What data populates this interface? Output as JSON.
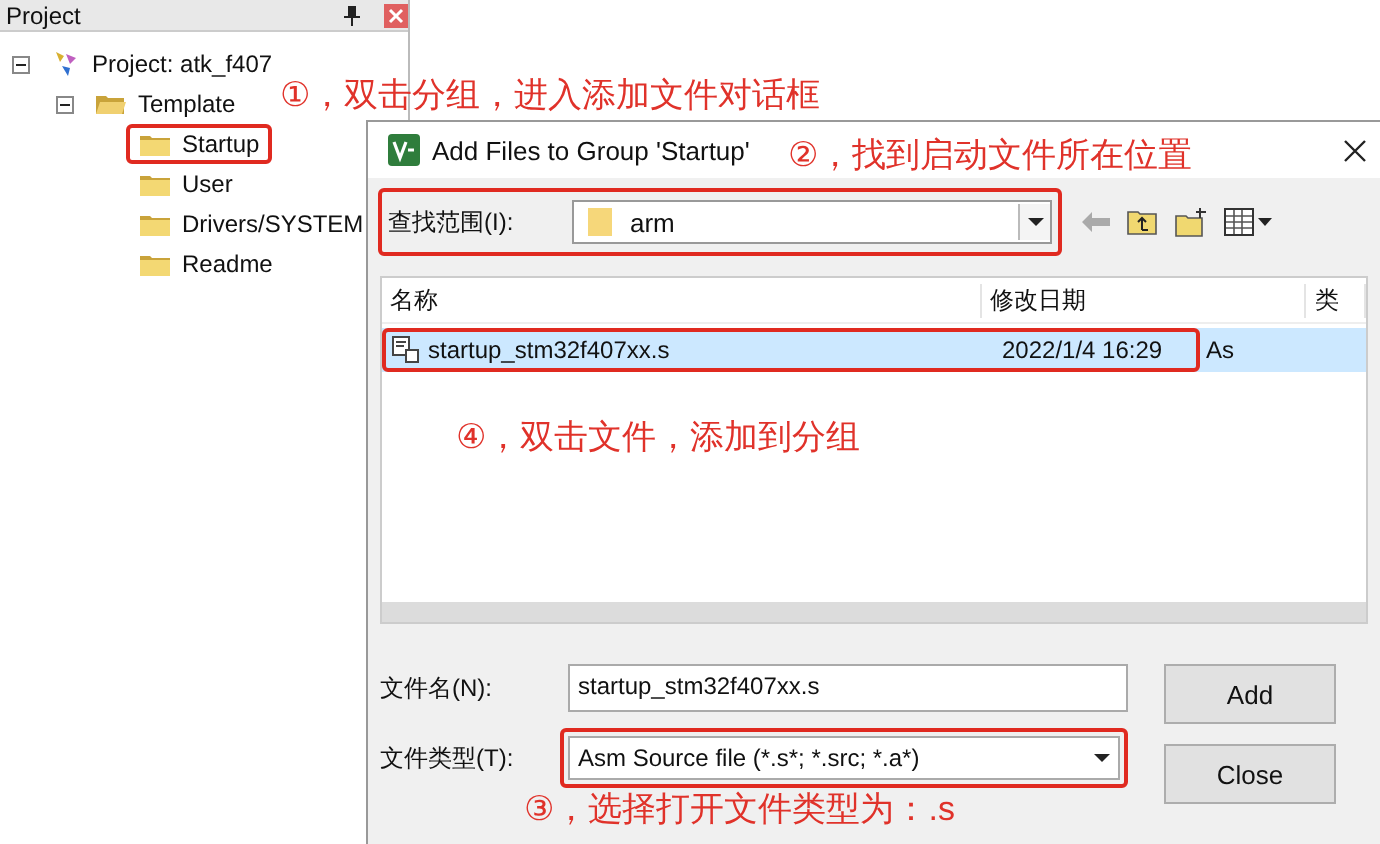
{
  "project_panel": {
    "title": "Project",
    "tree": [
      {
        "label": "Project: atk_f407",
        "kind": "project",
        "expanded": true,
        "highlighted": false,
        "children": [
          {
            "label": "Template",
            "kind": "group",
            "expanded": true,
            "highlighted": false,
            "children": [
              {
                "label": "Startup",
                "kind": "folder",
                "highlighted": true
              },
              {
                "label": "User",
                "kind": "folder",
                "highlighted": false
              },
              {
                "label": "Drivers/SYSTEM",
                "kind": "folder",
                "highlighted": false
              },
              {
                "label": "Readme",
                "kind": "folder",
                "highlighted": false
              }
            ]
          }
        ]
      }
    ]
  },
  "dialog": {
    "title": "Add Files to Group 'Startup'",
    "look_in": {
      "label": "查找范围(I):",
      "value": "arm",
      "highlighted": true
    },
    "columns": [
      "名称",
      "修改日期",
      "类"
    ],
    "files": [
      {
        "name": "startup_stm32f407xx.s",
        "date": "2022/1/4 16:29",
        "type": "As",
        "selected": true,
        "highlighted": true
      }
    ],
    "file_name": {
      "label": "文件名(N):",
      "value": "startup_stm32f407xx.s"
    },
    "file_type": {
      "label": "文件类型(T):",
      "value": "Asm Source file (*.s*; *.src; *.a*)",
      "highlighted": true
    },
    "buttons": [
      "Add",
      "Close"
    ]
  },
  "annotations": [
    {
      "text": "①，双击分组，进入添加文件对话框"
    },
    {
      "text": "②，找到启动文件所在位置"
    },
    {
      "text": "④，双击文件，添加到分组"
    },
    {
      "text": "③，选择打开文件类型为：.s"
    }
  ]
}
